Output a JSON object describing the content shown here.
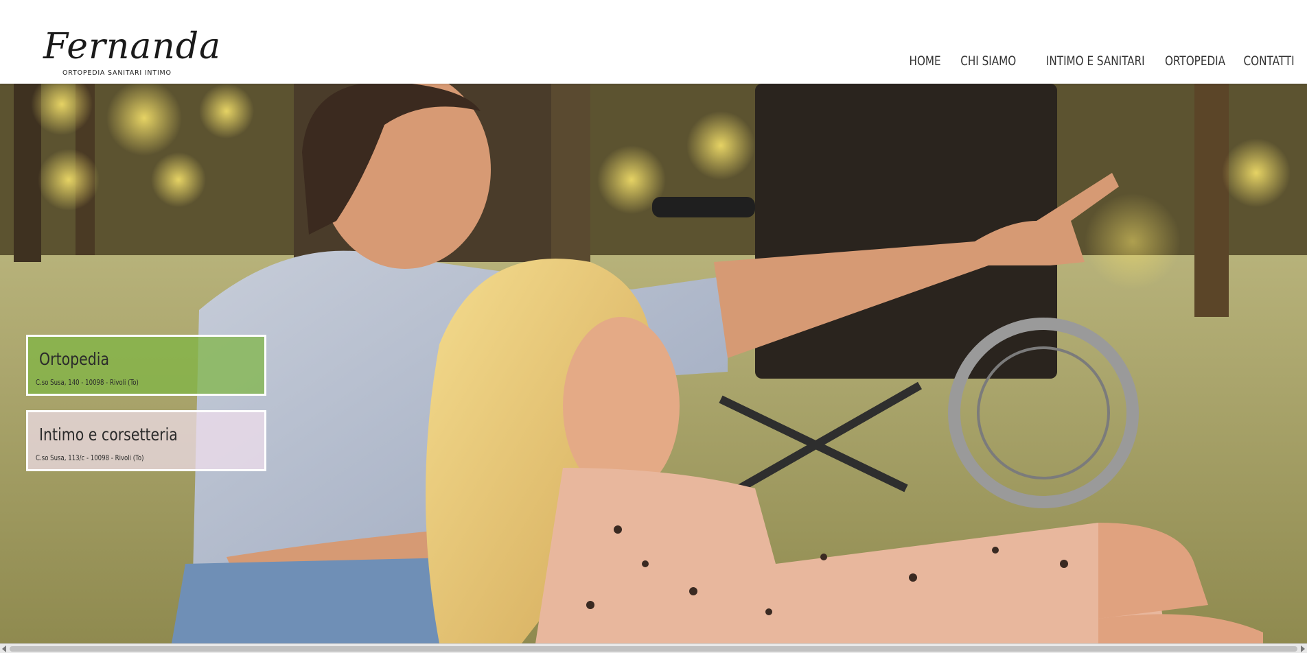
{
  "brand": {
    "logo_name": "Fernanda",
    "logo_tagline": "ORTOPEDIA SANITARI INTIMO"
  },
  "nav": {
    "items": [
      {
        "label": "HOME"
      },
      {
        "label": "CHI SIAMO"
      },
      {
        "label": "INTIMO E SANITARI"
      },
      {
        "label": "ORTOPEDIA"
      },
      {
        "label": "CONTATTI"
      }
    ]
  },
  "boxes": {
    "ortopedia": {
      "title": "Ortopedia",
      "address": "C.so Susa, 140 - 10098 - Rivoli (To)",
      "color": "#7eb543"
    },
    "intimo": {
      "title": "Intimo e corsetteria",
      "address": "C.so Susa, 113/c - 10098 - Rivoli (To)",
      "color": "#f0deec"
    }
  },
  "hero": {
    "image": "couple-in-park-with-wheelchair-photo"
  }
}
